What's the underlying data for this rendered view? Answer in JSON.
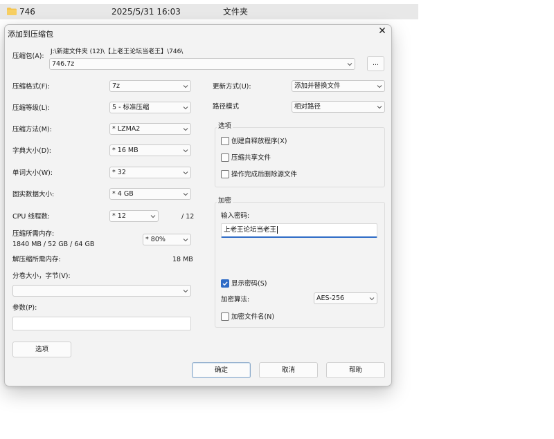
{
  "explorer": {
    "name": "746",
    "date": "2025/5/31 16:03",
    "type": "文件夹"
  },
  "dialog": {
    "title": "添加到压缩包",
    "archive": {
      "label": "压缩包(A):",
      "path": "J:\\新建文件夹 (12)\\【上老王论坛当老王】\\746\\",
      "name": "746.7z",
      "browse": "..."
    },
    "left": {
      "format_label": "压缩格式(F):",
      "format_value": "7z",
      "level_label": "压缩等级(L):",
      "level_value": "5 - 标准压缩",
      "method_label": "压缩方法(M):",
      "method_value": "*  LZMA2",
      "dict_label": "字典大小(D):",
      "dict_value": "*  16 MB",
      "word_label": "单词大小(W):",
      "word_value": "*  32",
      "solid_label": "固实数据大小:",
      "solid_value": "*  4 GB",
      "threads_label": "CPU 线程数:",
      "threads_value": "*  12",
      "threads_total": "/ 12",
      "mem_label": "压缩所需内存:",
      "mem_detail": "1840 MB / 52 GB / 64 GB",
      "mem_value": "*  80%",
      "decomp_label": "解压缩所需内存:",
      "decomp_value": "18 MB",
      "volume_label": "分卷大小，字节(V):",
      "volume_value": "",
      "params_label": "参数(P):",
      "params_value": "",
      "options_button": "选项"
    },
    "right": {
      "update_label": "更新方式(U):",
      "update_value": "添加并替换文件",
      "path_label": "路径模式",
      "path_value": "相对路径",
      "options_group": "选项",
      "opt_sfx": "创建自释放程序(X)",
      "opt_shared": "压缩共享文件",
      "opt_delete": "操作完成后删除源文件",
      "encrypt_group": "加密",
      "password_label": "输入密码:",
      "password_value": "上老王论坛当老王",
      "show_password": "显示密码(S)",
      "show_password_checked": true,
      "algo_label": "加密算法:",
      "algo_value": "AES-256",
      "encrypt_names": "加密文件名(N)"
    },
    "buttons": {
      "ok": "确定",
      "cancel": "取消",
      "help": "帮助"
    }
  },
  "colors": {
    "accent": "#2e6bc6",
    "folder": "#f4c34c"
  }
}
